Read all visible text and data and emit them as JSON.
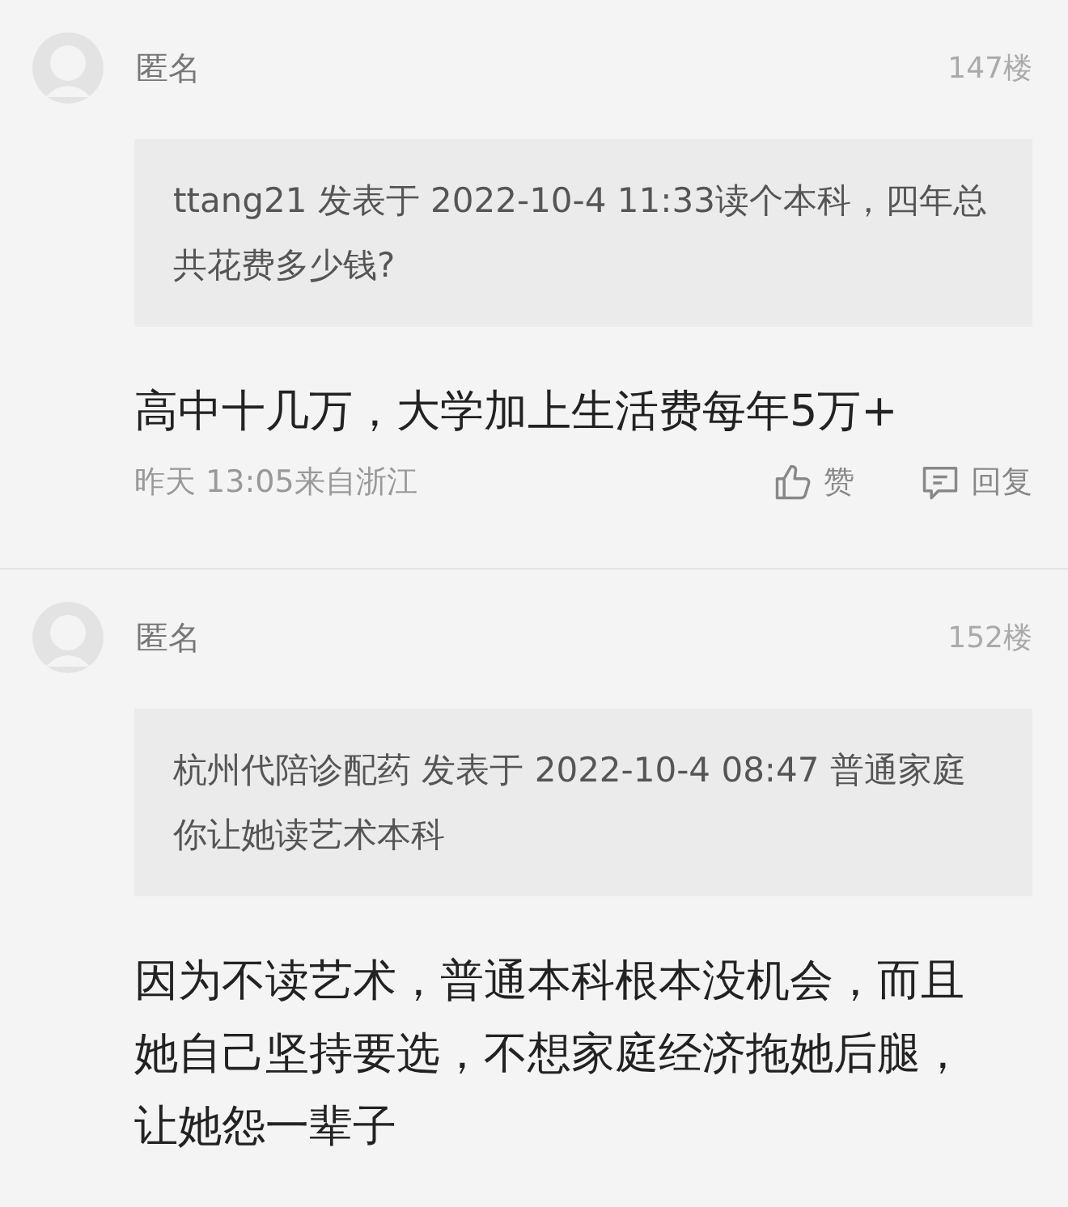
{
  "posts": [
    {
      "author": "匿名",
      "floor": "147楼",
      "quote": "ttang21 发表于 2022-10-4 11:33读个本科，四年总共花费多少钱?",
      "body": "高中十几万，大学加上生活费每年5万+",
      "footer": {
        "meta": "昨天 13:05来自浙江",
        "like": "赞",
        "reply": "回复"
      }
    },
    {
      "author": "匿名",
      "floor": "152楼",
      "quote": "杭州代陪诊配药 发表于 2022-10-4 08:47 普通家庭你让她读艺术本科",
      "body": "因为不读艺术，普通本科根本没机会，而且她自己坚持要选，不想家庭经济拖她后腿，让她怨一辈子"
    }
  ]
}
